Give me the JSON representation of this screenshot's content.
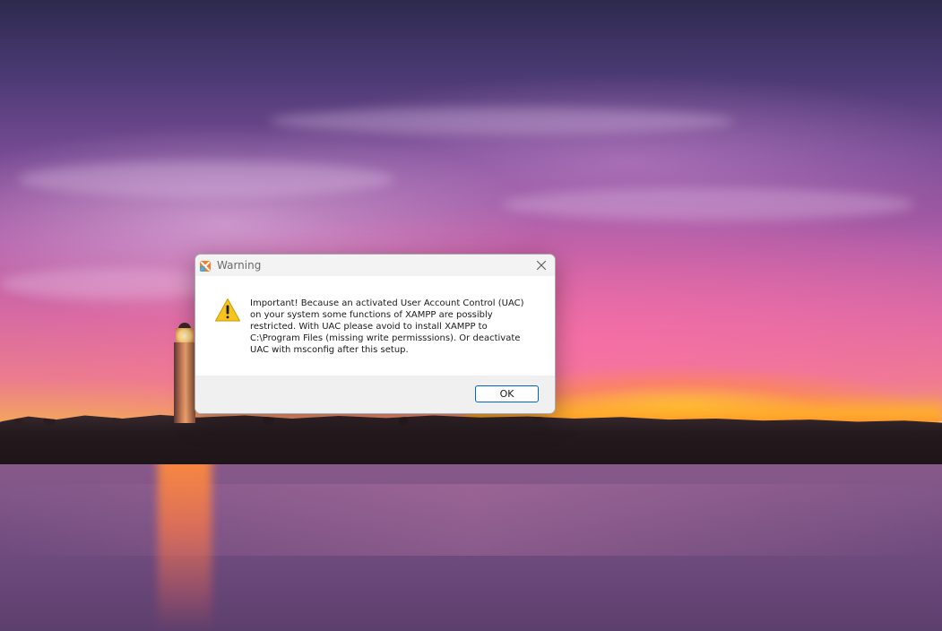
{
  "dialog": {
    "title": "Warning",
    "app_icon": "xampp-icon",
    "message_icon": "warning-triangle-icon",
    "message": "Important! Because an activated User Account Control (UAC)\non your system some functions of XAMPP are possibly\nrestricted. With UAC please avoid to install XAMPP to\nC:\\Program Files (missing write permisssions). Or deactivate\nUAC with msconfig after this setup.",
    "ok_label": "OK",
    "close_icon": "close-icon"
  },
  "desktop": {
    "wallpaper": "lighthouse-sunset"
  },
  "colors": {
    "button_border": "#0067c0",
    "warning_yellow": "#f7c31d",
    "titlebar_bg": "#f3f3f3",
    "footer_bg": "#f0f0f0"
  }
}
